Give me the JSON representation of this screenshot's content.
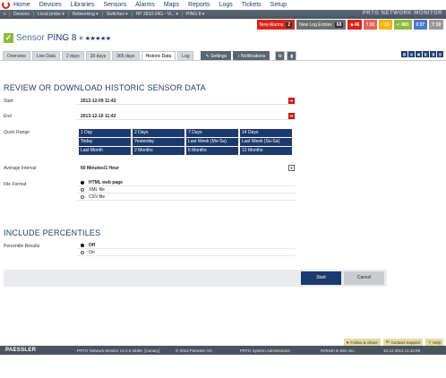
{
  "menu": {
    "items": [
      "Home",
      "Devices",
      "Libraries",
      "Sensors",
      "Alarms",
      "Maps",
      "Reports",
      "Logs",
      "Tickets",
      "Setup"
    ]
  },
  "breadcrumb": {
    "items": [
      "Devices",
      "Local probe ▾",
      "Networking ▾",
      "Switches ▾",
      "HP 2810-24G - Vi... ▾",
      "PING 8 ▾"
    ],
    "brand": "PRTG NETWORK MONITOR"
  },
  "alarms": {
    "new_alarms_label": "New Alarms",
    "new_alarms_count": "2",
    "new_log_label": "New Log Entries",
    "new_log_count": "68",
    "counts": [
      {
        "value": "46",
        "color": "#d9261c"
      },
      {
        "value": "10",
        "color": "#e8635b"
      },
      {
        "value": "13",
        "color": "#f4b400"
      },
      {
        "value": "883",
        "color": "#8dba3c"
      },
      {
        "value": "37",
        "color": "#4a78c8"
      },
      {
        "value": "19",
        "color": "#999999"
      }
    ]
  },
  "sensor": {
    "prefix": "Sensor",
    "name": "PING 8",
    "pin": "⊞",
    "stars": "★★★★★"
  },
  "tabs": {
    "overview": "Overview",
    "live": "Live Data",
    "d2": "2 days",
    "d30": "30 days",
    "d365": "365 days",
    "historic": "Historic Data",
    "log": "Log",
    "settings": "Settings",
    "notifications": "Notifications"
  },
  "form": {
    "heading": "REVIEW OR DOWNLOAD HISTORIC SENSOR DATA",
    "start_label": "Start",
    "start_value": "2013-12-09 11:42",
    "end_label": "End",
    "end_value": "2013-12-10 11:42",
    "quick_label": "Quick Range",
    "quick": [
      "1 Day",
      "2 Days",
      "7 Days",
      "14 Days",
      "Today",
      "Yesterday",
      "Last Week (Mo-Su)",
      "Last Week (Su-Sa)",
      "Last Month",
      "2 Months",
      "6 Months",
      "12 Months"
    ],
    "interval_label": "Average Interval",
    "interval_value": "60 Minutes/1 Hour",
    "format_label": "File Format",
    "formats": [
      "HTML web page",
      "XML file",
      "CSV file"
    ],
    "percentiles_heading": "INCLUDE PERCENTILES",
    "percentile_label": "Percentile Results",
    "percentile_options": [
      "Off",
      "On"
    ],
    "start_button": "Start",
    "cancel_button": "Cancel"
  },
  "footer": {
    "follow": "Follow & Share",
    "support": "Contact Support",
    "help": "Help",
    "logo": "PAESSLER",
    "version": "PRTG Network Monitor 13.4.9.3638+ [Canary]",
    "copyright": "© 2013 Paessler AG",
    "user": "PRTG System Administrator",
    "refresh": "Refresh in 591 sec.",
    "time": "10.12.2013 11:42:09"
  }
}
